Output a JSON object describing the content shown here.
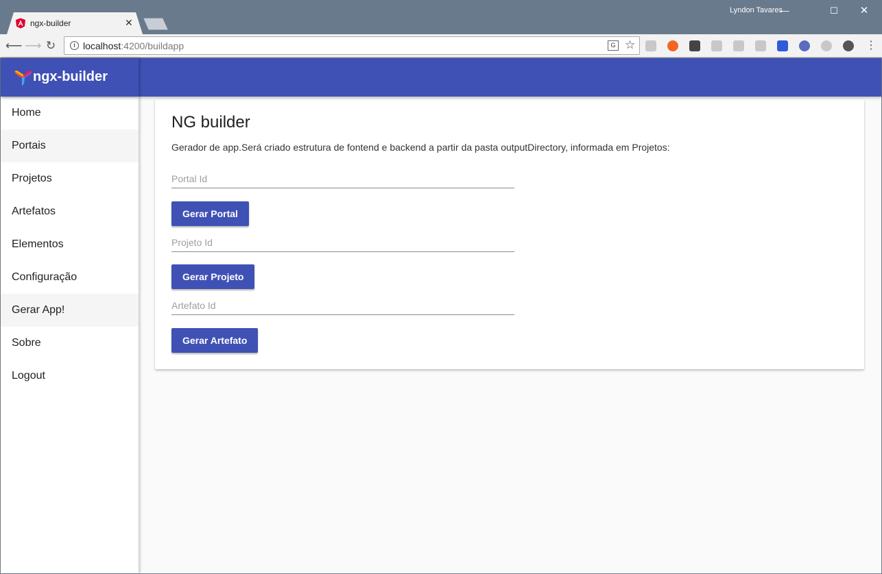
{
  "browser": {
    "tab_title": "ngx-builder",
    "profile_name": "Lyndon Tavares",
    "url_host": "localhost",
    "url_rest": ":4200/buildapp",
    "window_buttons": {
      "minimize": "—",
      "maximize": "☐",
      "close": "✕"
    },
    "extension_colors": [
      "#c8c8c8",
      "#f26522",
      "#444444",
      "#c8c8c8",
      "#c8c8c8",
      "#c8c8c8",
      "#2e5bd8",
      "#5c6bc0",
      "#c8c8c8",
      "#555555"
    ]
  },
  "app": {
    "brand": "ngx-builder",
    "accent_color": "#3f51b5"
  },
  "sidebar": {
    "items": [
      {
        "label": "Home",
        "active": false
      },
      {
        "label": "Portais",
        "active": true
      },
      {
        "label": "Projetos",
        "active": false
      },
      {
        "label": "Artefatos",
        "active": false
      },
      {
        "label": "Elementos",
        "active": false
      },
      {
        "label": "Configuração",
        "active": false
      },
      {
        "label": "Gerar App!",
        "active": true
      },
      {
        "label": "Sobre",
        "active": false
      },
      {
        "label": "Logout",
        "active": false
      }
    ]
  },
  "card": {
    "title": "NG builder",
    "subtitle": "Gerador de app.Será criado estrutura de fontend e backend a partir da pasta outputDirectory, informada em Projetos:",
    "portal": {
      "placeholder": "Portal Id",
      "value": "",
      "button": "Gerar Portal"
    },
    "projeto": {
      "placeholder": "Projeto Id",
      "value": "",
      "button": "Gerar Projeto"
    },
    "artefato": {
      "placeholder": "Artefato Id",
      "value": "",
      "button": "Gerar Artefato"
    }
  }
}
